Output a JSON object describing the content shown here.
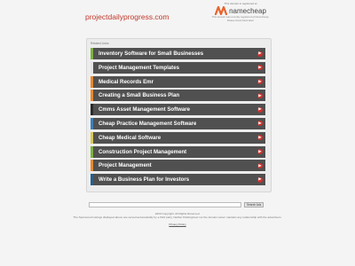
{
  "header": {
    "domain": "projectdailyprogress.com"
  },
  "registrar": {
    "top_text": "This domain is registered at",
    "name": "namecheap",
    "note": "This domain was recently registered at Namecheap. Please check back later!"
  },
  "related": {
    "header": "Related Links",
    "items": [
      {
        "label": "Inventory Software for Small Businesses",
        "accent": "#7fb241"
      },
      {
        "label": "Project Management Templates",
        "accent": "#e4e4e4"
      },
      {
        "label": "Medical Records Emr",
        "accent": "#e88a2e"
      },
      {
        "label": "Creating a Small Business Plan",
        "accent": "#e88a2e"
      },
      {
        "label": "Cmms Asset Management Software",
        "accent": "#2b2b2b"
      },
      {
        "label": "Cheap Practice Management Software",
        "accent": "#3d7fb8"
      },
      {
        "label": "Cheap Medical Software",
        "accent": "#d9c957"
      },
      {
        "label": "Construction Project Management",
        "accent": "#7fb241"
      },
      {
        "label": "Project Management",
        "accent": "#e88a2e"
      },
      {
        "label": "Write a Business Plan for Investors",
        "accent": "#2b5f8a"
      }
    ],
    "arrow_color": "#d0302b"
  },
  "search": {
    "placeholder": "",
    "button_label": "Search Ads"
  },
  "footer": {
    "copyright": "2020 Copyright. All Rights Reserved.",
    "disclaimer": "The Sponsored Listings displayed above are served automatically by a third party. Neither Parkingcrew nor the domain owner maintain any relationship with the advertisers.",
    "privacy": "Privacy Policy"
  }
}
